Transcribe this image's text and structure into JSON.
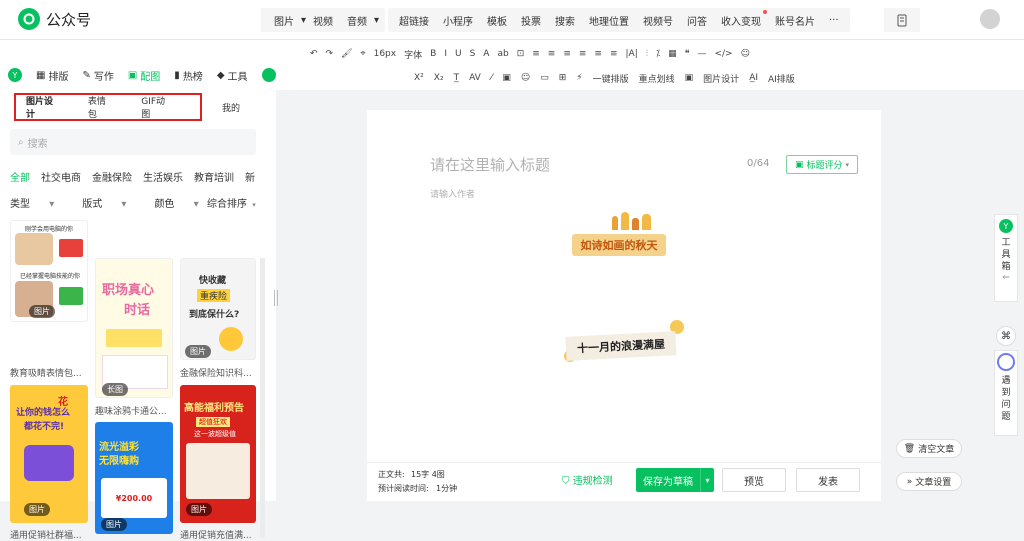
{
  "brand": {
    "name": "公众号"
  },
  "topnav": {
    "group1": [
      {
        "label": "图片",
        "dd": true
      },
      {
        "label": "视频",
        "dd": false
      },
      {
        "label": "音频",
        "dd": true
      }
    ],
    "group2": [
      {
        "label": "超链接"
      },
      {
        "label": "小程序"
      },
      {
        "label": "模板"
      },
      {
        "label": "投票"
      },
      {
        "label": "搜索"
      },
      {
        "label": "地理位置"
      },
      {
        "label": "视频号"
      },
      {
        "label": "问答"
      },
      {
        "label": "收入变现"
      },
      {
        "label": "账号名片"
      },
      {
        "label": "···"
      }
    ]
  },
  "toolbar": {
    "row1": [
      "↶",
      "↷",
      "🖌",
      "⌖",
      "16px",
      "字体",
      "B",
      "I",
      "U",
      "S",
      "A",
      "ab",
      "⊡",
      "≡",
      "≡",
      "≡",
      "≡",
      "≡",
      "≡",
      "|A|",
      "⫶",
      "⁒",
      "▦",
      "❝",
      "—",
      "</>",
      "☺"
    ],
    "row2": [
      "X²",
      "X₂",
      "T̲",
      "AV",
      "⁄",
      "▣",
      "☺",
      "▭",
      "⊞",
      "⚡",
      "一键排版",
      "重点划线",
      "▣",
      "图片设计",
      "A̲I",
      "AI排版"
    ]
  },
  "sidetabs": [
    {
      "icon": "Y",
      "label": ""
    },
    {
      "icon": "▦",
      "label": "排版"
    },
    {
      "icon": "✎",
      "label": "写作"
    },
    {
      "icon": "▣",
      "label": "配图"
    },
    {
      "icon": "▮",
      "label": "热榜"
    },
    {
      "icon": "◆",
      "label": "工具"
    }
  ],
  "subtabs": [
    "图片设计",
    "表情包",
    "GIF动图"
  ],
  "mine": "我的",
  "search": {
    "placeholder": "搜索"
  },
  "categories": [
    "全部",
    "社交电商",
    "金融保险",
    "生活娱乐",
    "教育培训",
    "新"
  ],
  "filters": {
    "type": "类型",
    "format": "版式",
    "color": "颜色",
    "sort": "综合排序"
  },
  "cards": [
    {
      "caption": "教育吸睛表情包...",
      "badge": "图片",
      "t1": "刚学会用电脑的你",
      "t2": "已经掌握电脑技能的你"
    },
    {
      "caption": "趣味涂鸦卡通公...",
      "badge": "长图",
      "t1": "职场真心",
      "t2": "时话"
    },
    {
      "caption": "金融保险知识科...",
      "badge": "图片",
      "t1": "快收藏",
      "t2": "重疾险",
      "t3": "到底保什么?"
    },
    {
      "caption": "通用促销社群福...",
      "badge": "图片",
      "t1": "让你的钱怎么",
      "t2": "花",
      "t3": "都花不完!"
    },
    {
      "caption": "",
      "badge": "图片",
      "t1": "流光溢彩",
      "t2": "无限嗨购",
      "t3": "¥200.00"
    },
    {
      "caption": "通用促销充值满...",
      "badge": "图片",
      "t1": "高能福利预告",
      "t2": "超值狂欢",
      "t3": "这一波超级值"
    }
  ],
  "editor": {
    "title_placeholder": "请在这里输入标题",
    "count": "0/64",
    "score": "标题评分",
    "author_placeholder": "请输入作者",
    "banner1": "如诗如画的秋天",
    "banner2": "十一月的浪漫满屋"
  },
  "footer": {
    "words_label": "正文共:",
    "words_value": "15字 4图",
    "time_label": "预计阅读时间:",
    "time_value": "1分钟",
    "check": "违规检测",
    "save": "保存为草稿",
    "preview": "预览",
    "publish": "发表"
  },
  "right": {
    "toolbox": "工具箱",
    "meet": "遇到问题",
    "clear": "清空文章",
    "settings": "文章设置"
  }
}
